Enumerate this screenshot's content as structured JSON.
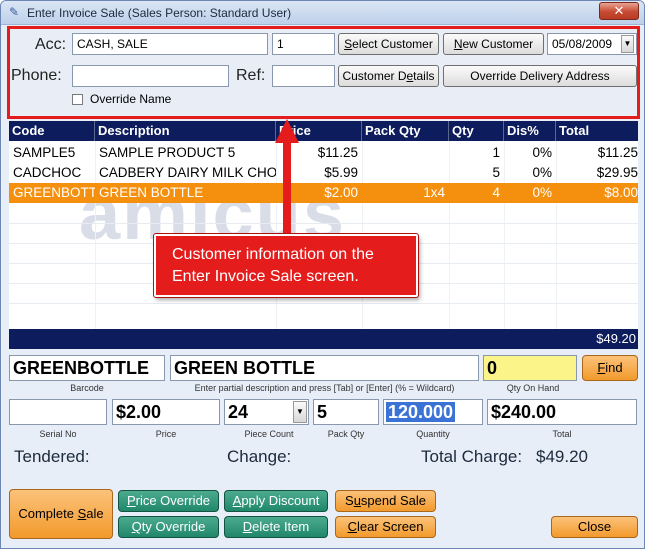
{
  "window": {
    "title": "Enter Invoice Sale (Sales Person: Standard User)",
    "close_glyph": "✕",
    "icon": "invoice-icon"
  },
  "header": {
    "acc_label": "Acc:",
    "acc_value": "CASH, SALE",
    "acc_number": "1",
    "select_customer": "Select Customer",
    "new_customer": "New Customer",
    "date": "05/08/2009",
    "phone_label": "Phone:",
    "phone_value": "",
    "ref_label": "Ref:",
    "ref_value": "",
    "customer_details": "Customer Details",
    "override_delivery": "Override Delivery Address",
    "override_name": "Override Name",
    "override_name_checked": false
  },
  "grid": {
    "columns": [
      "Code",
      "Description",
      "Price",
      "Pack Qty",
      "Qty",
      "Dis%",
      "Total"
    ],
    "rows": [
      {
        "code": "SAMPLE5",
        "description": "SAMPLE PRODUCT 5",
        "price": "$11.25",
        "pack_qty": "",
        "qty": "1",
        "dis": "0%",
        "total": "$11.25",
        "selected": false
      },
      {
        "code": "CADCHOC",
        "description": "CADBERY DAIRY MILK CHO",
        "price": "$5.99",
        "pack_qty": "",
        "qty": "5",
        "dis": "0%",
        "total": "$29.95",
        "selected": false
      },
      {
        "code": "GREENBOTT",
        "description": "GREEN BOTTLE",
        "price": "$2.00",
        "pack_qty": "1x4",
        "qty": "4",
        "dis": "0%",
        "total": "$8.00",
        "selected": true
      }
    ],
    "watermark": "amicus",
    "grand_total": "$49.20"
  },
  "callout": {
    "line1": "Customer information on the",
    "line2": "Enter Invoice Sale screen."
  },
  "entry": {
    "barcode": "GREENBOTTLE",
    "description": "GREEN BOTTLE",
    "qty_on_hand": "0",
    "find": "Find",
    "barcode_caption": "Barcode",
    "desc_caption": "Enter partial description and press [Tab] or [Enter] (% = Wildcard)",
    "qoh_caption": "Qty On Hand",
    "serial_no": "",
    "price": "$2.00",
    "piece_count": "24",
    "pack_qty": "5",
    "quantity": "120.000",
    "total": "$240.00",
    "serial_caption": "Serial No",
    "price_caption": "Price",
    "piece_caption": "Piece Count",
    "pack_caption": "Pack Qty",
    "quantity_caption": "Quantity",
    "total_caption": "Total"
  },
  "summary": {
    "tendered_label": "Tendered:",
    "change_label": "Change:",
    "total_charge_label": "Total Charge:",
    "total_charge_value": "$49.20"
  },
  "buttons": {
    "complete_sale": "Complete Sale",
    "price_override": "Price Override",
    "apply_discount": "Apply Discount",
    "suspend_sale": "Suspend Sale",
    "qty_override": "Qty Override",
    "delete_item": "Delete Item",
    "clear_screen": "Clear Screen",
    "close": "Close"
  },
  "colors": {
    "accent_red": "#e41c1c",
    "header_navy": "#0d1c5c",
    "selected_orange": "#f5900e",
    "button_green": "#21876a",
    "qoh_yellow": "#fbf589"
  }
}
